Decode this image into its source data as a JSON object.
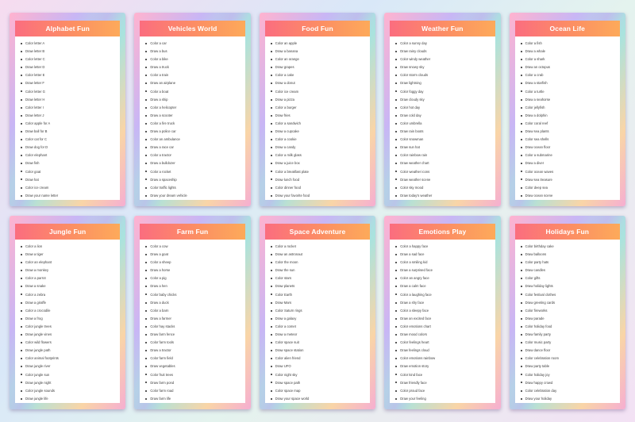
{
  "cards": [
    {
      "title": "Alphabet Fun",
      "items": [
        "Color letter A",
        "Draw letter B",
        "Color letter C",
        "Draw letter D",
        "Color letter E",
        "Draw letter F",
        "Color letter G",
        "Draw letter H",
        "Color letter I",
        "Draw letter J",
        "Color apple for A",
        "Draw ball for B",
        "Color cat for C",
        "Draw dog for D",
        "Color elephant",
        "Draw fish",
        "Color goat",
        "Draw hat",
        "Color ice cream",
        "Draw your name letter"
      ]
    },
    {
      "title": "Vehicles World",
      "items": [
        "Color a car",
        "Draw a bus",
        "Color a bike",
        "Draw a truck",
        "Color a train",
        "Draw an airplane",
        "Color a boat",
        "Draw a ship",
        "Color a helicopter",
        "Draw a scooter",
        "Color a fire truck",
        "Draw a police car",
        "Color an ambulance",
        "Draw a race car",
        "Color a tractor",
        "Draw a bulldozer",
        "Color a rocket",
        "Draw a spaceship",
        "Color traffic lights",
        "Draw your dream vehicle"
      ]
    },
    {
      "title": "Food Fun",
      "items": [
        "Color an apple",
        "Draw a banana",
        "Color an orange",
        "Draw grapes",
        "Color a cake",
        "Draw a donut",
        "Color ice cream",
        "Draw a pizza",
        "Color a burger",
        "Draw fries",
        "Color a sandwich",
        "Draw a cupcake",
        "Color a cookie",
        "Draw a candy",
        "Color a milk glass",
        "Draw a juice box",
        "Color a breakfast plate",
        "Draw lunch food",
        "Color dinner food",
        "Draw your favorite food"
      ]
    },
    {
      "title": "Weather Fun",
      "items": [
        "Color a sunny day",
        "Draw rainy clouds",
        "Color windy weather",
        "Draw snowy sky",
        "Color storm clouds",
        "Draw lightning",
        "Color foggy day",
        "Draw cloudy sky",
        "Color hot day",
        "Draw cold day",
        "Color umbrella",
        "Draw rain boots",
        "Color snowman",
        "Draw sun hat",
        "Color rainbow rain",
        "Draw weather chart",
        "Color weather icons",
        "Draw weather scene",
        "Color sky mood",
        "Draw today's weather"
      ]
    },
    {
      "title": "Ocean Life",
      "items": [
        "Color a fish",
        "Draw a whale",
        "Color a shark",
        "Draw an octopus",
        "Color a crab",
        "Draw a starfish",
        "Color a turtle",
        "Draw a seahorse",
        "Color jellyfish",
        "Draw a dolphin",
        "Color coral reef",
        "Draw sea plants",
        "Color sea shells",
        "Draw ocean floor",
        "Color a submarine",
        "Draw a diver",
        "Color ocean waves",
        "Draw sea treasure",
        "Color deep sea",
        "Draw ocean scene"
      ]
    },
    {
      "title": "Jungle Fun",
      "items": [
        "Color a lion",
        "Draw a tiger",
        "Color an elephant",
        "Draw a monkey",
        "Color a parrot",
        "Draw a snake",
        "Color a zebra",
        "Draw a giraffe",
        "Color a crocodile",
        "Draw a frog",
        "Color jungle trees",
        "Draw jungle vines",
        "Color wild flowers",
        "Draw jungle path",
        "Color animal footprints",
        "Draw jungle river",
        "Color jungle sun",
        "Draw jungle night",
        "Color jungle sounds",
        "Draw jungle life"
      ]
    },
    {
      "title": "Farm Fun",
      "items": [
        "Color a cow",
        "Draw a goat",
        "Color a sheep",
        "Draw a horse",
        "Color a pig",
        "Draw a hen",
        "Color baby chicks",
        "Draw a duck",
        "Color a barn",
        "Draw a farmer",
        "Color hay stacks",
        "Draw farm fence",
        "Color farm tools",
        "Draw a tractor",
        "Color farm field",
        "Draw vegetables",
        "Color fruit trees",
        "Draw farm pond",
        "Color farm road",
        "Draw farm life"
      ]
    },
    {
      "title": "Space Adventure",
      "items": [
        "Color a rocket",
        "Draw an astronaut",
        "Color the moon",
        "Draw the sun",
        "Color stars",
        "Draw planets",
        "Color Earth",
        "Draw Mars",
        "Color Saturn rings",
        "Draw a galaxy",
        "Color a comet",
        "Draw a meteor",
        "Color space suit",
        "Draw space station",
        "Color alien friend",
        "Draw UFO",
        "Color night sky",
        "Draw space path",
        "Color space map",
        "Draw your space world"
      ]
    },
    {
      "title": "Emotions Play",
      "items": [
        "Color a happy face",
        "Draw a sad face",
        "Color a smiling kid",
        "Draw a surprised face",
        "Color an angry face",
        "Draw a calm face",
        "Color a laughing face",
        "Draw a shy face",
        "Color a sleepy face",
        "Draw an excited face",
        "Color emotions chart",
        "Draw mood colors",
        "Color feelings heart",
        "Draw feelings cloud",
        "Color emotions rainbow",
        "Draw emotion story",
        "Color kind face",
        "Draw friendly face",
        "Color proud face",
        "Draw your feeling"
      ]
    },
    {
      "title": "Holidays Fun",
      "items": [
        "Color birthday cake",
        "Draw balloons",
        "Color party hats",
        "Draw candles",
        "Color gifts",
        "Draw holiday lights",
        "Color festival clothes",
        "Draw greeting cards",
        "Color fireworks",
        "Draw parade",
        "Color holiday food",
        "Draw family party",
        "Color music party",
        "Draw dance floor",
        "Color celebration room",
        "Draw party table",
        "Color holiday joy",
        "Draw happy crowd",
        "Color celebration day",
        "Draw your holiday"
      ]
    }
  ]
}
